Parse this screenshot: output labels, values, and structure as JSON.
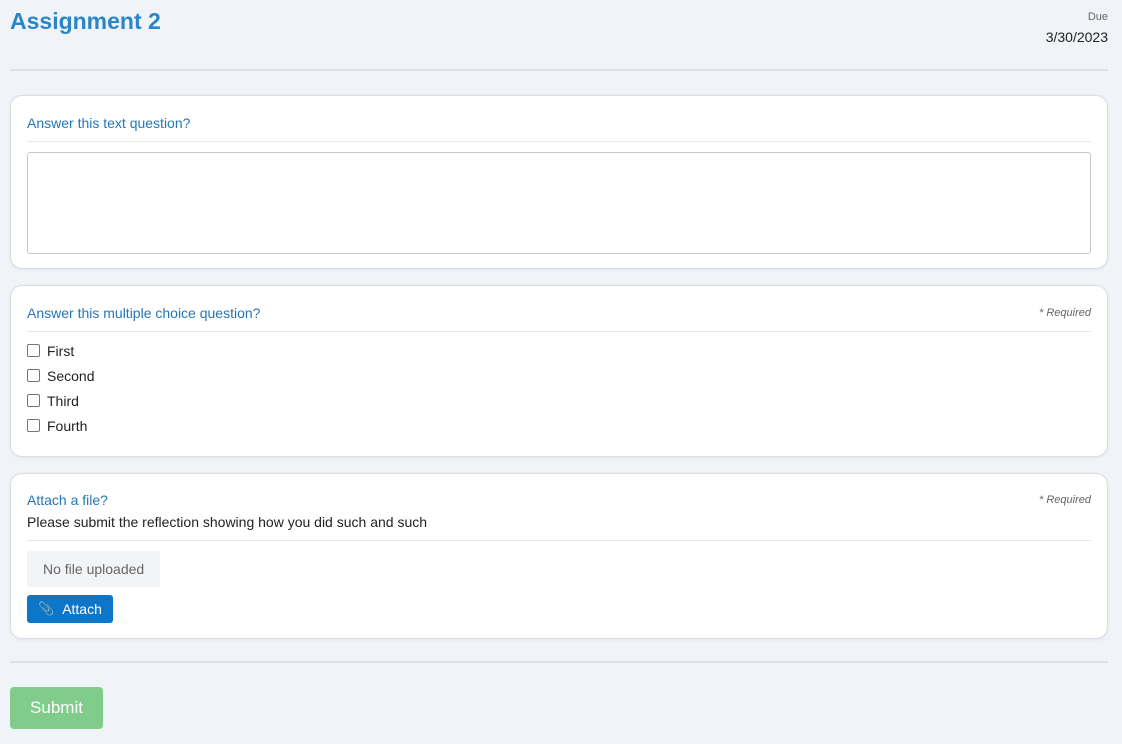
{
  "header": {
    "title": "Assignment 2",
    "due_label": "Due",
    "due_date": "3/30/2023"
  },
  "questions": [
    {
      "title": "Answer this text question?",
      "type": "text",
      "value": "",
      "placeholder": ""
    },
    {
      "title": "Answer this multiple choice question?",
      "type": "multiple-choice",
      "required_label": "* Required",
      "options": [
        {
          "label": "First",
          "checked": false
        },
        {
          "label": "Second",
          "checked": false
        },
        {
          "label": "Third",
          "checked": false
        },
        {
          "label": "Fourth",
          "checked": false
        }
      ]
    },
    {
      "title": "Attach a file?",
      "type": "file",
      "required_label": "* Required",
      "description": "Please submit the reflection showing how you did such and such",
      "file_status": "No file uploaded",
      "attach_label": "Attach"
    }
  ],
  "submit_label": "Submit",
  "colors": {
    "title": "#2a86c6",
    "question_title": "#2577b4",
    "attach_button": "#0e76c9",
    "submit_button": "#80cc8a",
    "background": "#f0f3f7"
  },
  "icons": {
    "attach": "paperclip-icon"
  }
}
